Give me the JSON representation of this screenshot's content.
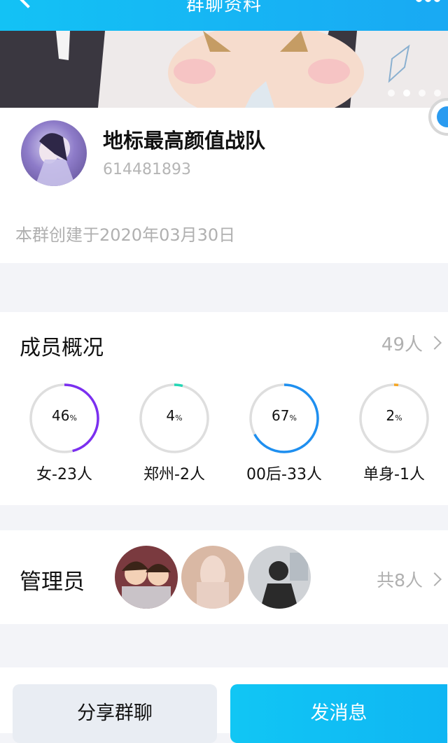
{
  "header": {
    "title": "群聊资料"
  },
  "group": {
    "name": "地标最高颜值战队",
    "id": "614481893",
    "created": "本群创建于2020年03月30日"
  },
  "members": {
    "title": "成员概况",
    "count": "49人",
    "stats": [
      {
        "pct": "46",
        "unit": "%",
        "label": "女-23人",
        "value": 0.46,
        "color": "#7b2ff0"
      },
      {
        "pct": "4",
        "unit": "%",
        "label": "郑州-2人",
        "value": 0.04,
        "color": "#23d7b5"
      },
      {
        "pct": "67",
        "unit": "%",
        "label": "00后-33人",
        "value": 0.67,
        "color": "#1e8ff0"
      },
      {
        "pct": "2",
        "unit": "%",
        "label": "单身-1人",
        "value": 0.02,
        "color": "#f5a623"
      }
    ]
  },
  "admin": {
    "title": "管理员",
    "total": "共8人"
  },
  "actions": {
    "share": "分享群聊",
    "send": "发消息"
  },
  "banner": {
    "slide_count": 4,
    "active_slide": 2
  }
}
